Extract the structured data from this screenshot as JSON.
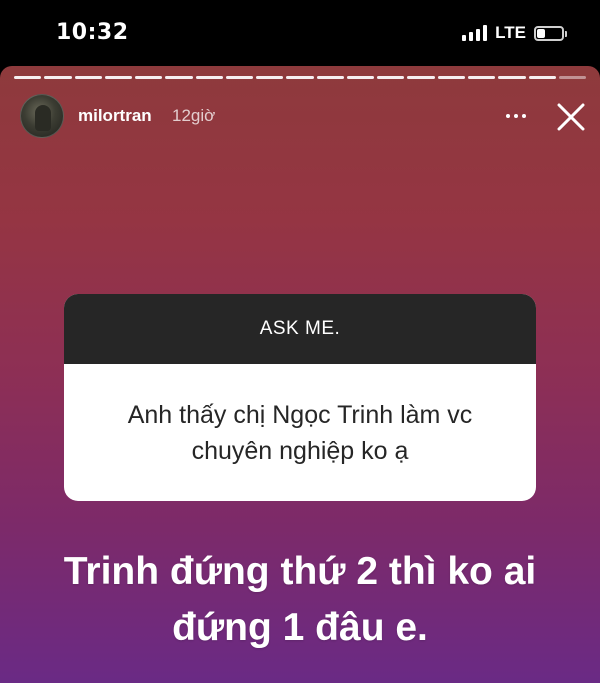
{
  "status_bar": {
    "time": "10:32",
    "network": "LTE",
    "battery_level": 0.35
  },
  "story": {
    "username": "milortran",
    "time_ago": "12giờ",
    "progress_segments": 19,
    "question_sticker": {
      "title": "ASK ME.",
      "question": "Anh thấy chị Ngọc Trinh làm vc chuyên nghiệp ko ạ"
    },
    "answer": "Trinh đứng thứ 2 thì ko ai đứng 1 đâu e."
  },
  "colors": {
    "background_top": "#8e3a3c",
    "background_bottom": "#6a2a85",
    "sticker_header": "#262626"
  },
  "icons": [
    "signal-icon",
    "battery-icon",
    "more-options-icon",
    "close-icon"
  ]
}
